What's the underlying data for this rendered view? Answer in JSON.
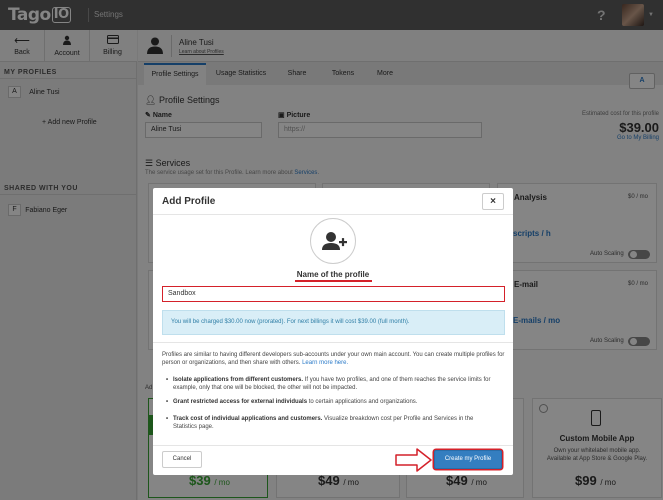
{
  "app": {
    "logo_main": "Tago",
    "logo_io": "IO",
    "section": "Settings",
    "help": "?"
  },
  "nav": {
    "back": "Back",
    "account": "Account",
    "billing": "Billing"
  },
  "sidebar": {
    "my_profiles_heading": "MY PROFILES",
    "my_profiles": [
      {
        "badge": "A",
        "name": "Aline Tusi"
      }
    ],
    "add_new": "+ Add new Profile",
    "shared_heading": "SHARED WITH YOU",
    "shared": [
      {
        "badge": "F",
        "name": "Fabiano Eger"
      }
    ]
  },
  "profile_header": {
    "name": "Aline Tusi",
    "link": "Learn about Profiles"
  },
  "tabs": [
    {
      "label": "Profile Settings",
      "active": true
    },
    {
      "label": "Usage Statistics",
      "active": false
    },
    {
      "label": "Share",
      "active": false
    },
    {
      "label": "Tokens",
      "active": false
    },
    {
      "label": "More",
      "active": false
    }
  ],
  "a_button": "A",
  "settings": {
    "heading": "Profile Settings",
    "name_label": "Name",
    "name_value": "Aline Tusi",
    "picture_label": "Picture",
    "picture_placeholder": "https://",
    "estimated_label": "Estimated cost for this profile",
    "estimated_price": "$39.00",
    "billing_link": "Go to My Billing"
  },
  "services": {
    "heading": "Services",
    "desc_prefix": "The service usage set for this Profile. Learn more about ",
    "desc_link": "Services",
    "desc_suffix": ".",
    "analysis": {
      "title": "Analysis",
      "price": "$0 / mo",
      "link": "scripts / h",
      "scaling": "Auto Scaling"
    },
    "email": {
      "title": "E-mail",
      "price": "$0 / mo",
      "link": "E-mails / mo",
      "scaling": "Auto Scaling"
    }
  },
  "plans": {
    "p1": {
      "amount": "$39",
      "unit": "/ mo"
    },
    "p2": {
      "amount": "$49",
      "unit": "/ mo"
    },
    "p3": {
      "amount": "$49",
      "unit": "/ mo"
    },
    "p4": {
      "amount": "$99",
      "unit": "/ mo"
    },
    "custom_title": "Custom Mobile App",
    "custom_desc1": "Own your whitelabel mobile app.",
    "custom_desc2": "Available at App Store & Google Play."
  },
  "background_labels": {
    "ad": "Ad"
  },
  "modal": {
    "title": "Add Profile",
    "close": "×",
    "name_label": "Name of the profile",
    "input_value": "Sandbox",
    "charge": "You will be charged $30.00 now (prorated). For next billings it will cost $39.00 (full month).",
    "desc": "Profiles are similar to having different developers sub-accounts under your own main account. You can create multiple profiles for person or organizations, and then share with others. ",
    "desc_link": "Learn more here.",
    "bullets": [
      {
        "bold": "Isolate applications from different customers.",
        "text": " If you have two profiles, and one of them reaches the service limits for example, only that one will be blocked, the other will not be impacted."
      },
      {
        "bold": "Grant restricted access for external individuals",
        "text": " to certain applications and organizations."
      },
      {
        "bold": "Track cost of individual applications and customers.",
        "text": " Visualize breakdown cost per Profile and Services in the Statistics page."
      }
    ],
    "cancel": "Cancel",
    "create": "Create my Profile"
  },
  "colors": {
    "accent": "#2a7ac8",
    "topbar": "#5c5c5c",
    "annotation_red": "#d4212a",
    "green": "#39a535"
  }
}
